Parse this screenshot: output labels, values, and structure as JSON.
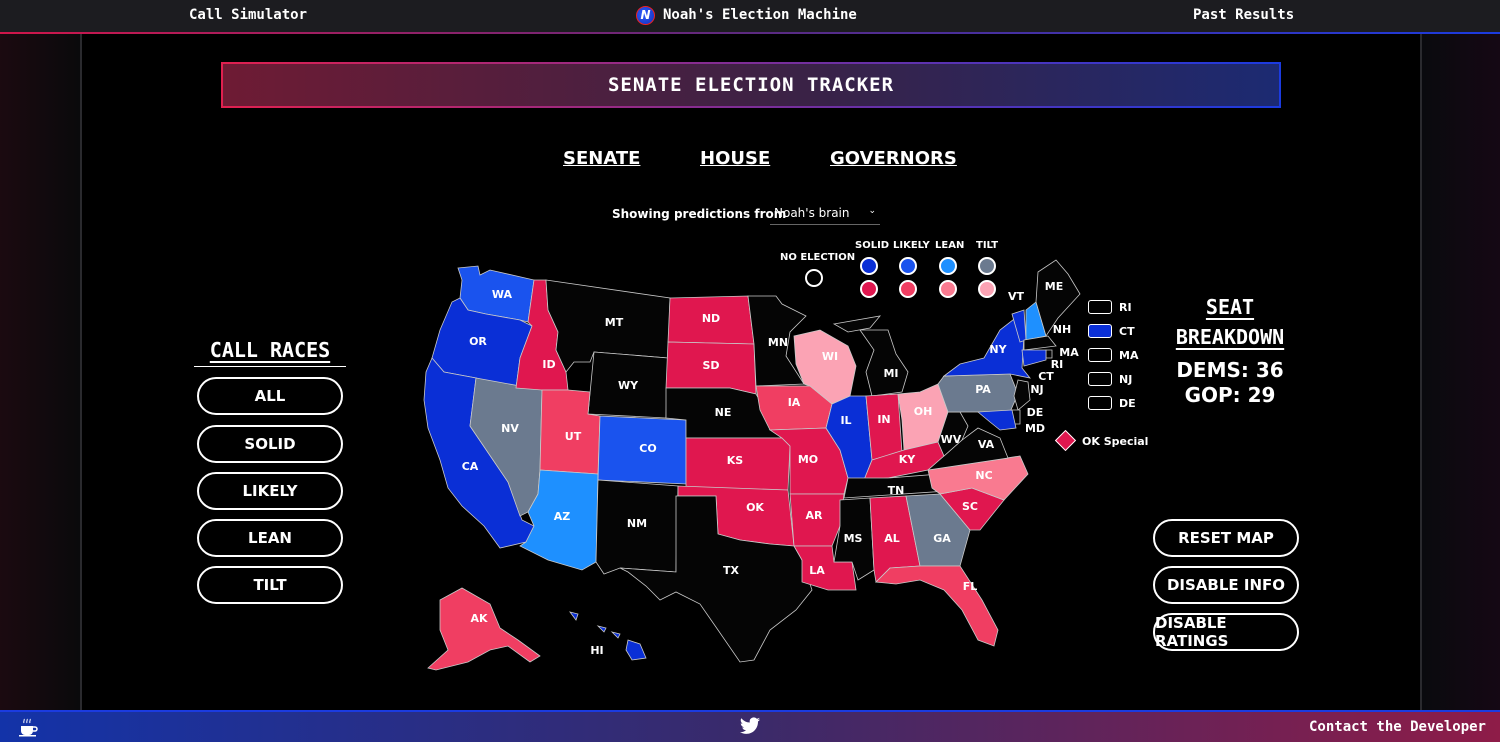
{
  "header": {
    "left_link": "Call Simulator",
    "brand": "Noah's Election Machine",
    "brand_logo_letter": "N",
    "right_link": "Past Results"
  },
  "banner": {
    "title": "SENATE ELECTION TRACKER"
  },
  "tabs": [
    "SENATE",
    "HOUSE",
    "GOVERNORS"
  ],
  "predictions": {
    "label": "Showing predictions from",
    "selected": "Noah's brain"
  },
  "legend": {
    "no_election": "NO ELECTION",
    "columns": [
      "SOLID",
      "LIKELY",
      "LEAN",
      "TILT"
    ],
    "dem_colors": [
      "#0a2fd6",
      "#1a53ee",
      "#1e90ff",
      "#6b7a8f"
    ],
    "gop_colors": [
      "#e0174f",
      "#f03e62",
      "#f97a90",
      "#fba3b4"
    ]
  },
  "small_states": [
    {
      "label": "RI",
      "color": "#000000"
    },
    {
      "label": "CT",
      "color": "#0a2fd6"
    },
    {
      "label": "MA",
      "color": "#000000"
    },
    {
      "label": "NJ",
      "color": "#000000"
    },
    {
      "label": "DE",
      "color": "#000000"
    }
  ],
  "special": {
    "label": "OK Special",
    "color": "#e0174f"
  },
  "call_races": {
    "title": "CALL RACES",
    "buttons": [
      "ALL",
      "SOLID",
      "LIKELY",
      "LEAN",
      "TILT"
    ]
  },
  "seat_breakdown": {
    "title_line1": "SEAT",
    "title_line2": "BREAKDOWN",
    "dems": "DEMS: 36",
    "gop": "GOP: 29"
  },
  "controls": [
    "RESET MAP",
    "DISABLE INFO",
    "DISABLE RATINGS"
  ],
  "map_states": [
    {
      "abbr": "WA",
      "rating": "likely-dem"
    },
    {
      "abbr": "OR",
      "rating": "solid-dem"
    },
    {
      "abbr": "CA",
      "rating": "solid-dem"
    },
    {
      "abbr": "NV",
      "rating": "tilt-dem"
    },
    {
      "abbr": "ID",
      "rating": "solid-gop"
    },
    {
      "abbr": "MT",
      "rating": "no-election"
    },
    {
      "abbr": "WY",
      "rating": "no-election"
    },
    {
      "abbr": "UT",
      "rating": "likely-gop"
    },
    {
      "abbr": "AZ",
      "rating": "lean-dem"
    },
    {
      "abbr": "CO",
      "rating": "likely-dem"
    },
    {
      "abbr": "NM",
      "rating": "no-election"
    },
    {
      "abbr": "ND",
      "rating": "solid-gop"
    },
    {
      "abbr": "SD",
      "rating": "solid-gop"
    },
    {
      "abbr": "NE",
      "rating": "no-election"
    },
    {
      "abbr": "KS",
      "rating": "solid-gop"
    },
    {
      "abbr": "OK",
      "rating": "solid-gop"
    },
    {
      "abbr": "TX",
      "rating": "no-election"
    },
    {
      "abbr": "MN",
      "rating": "no-election"
    },
    {
      "abbr": "IA",
      "rating": "likely-gop"
    },
    {
      "abbr": "MO",
      "rating": "solid-gop"
    },
    {
      "abbr": "AR",
      "rating": "solid-gop"
    },
    {
      "abbr": "LA",
      "rating": "solid-gop"
    },
    {
      "abbr": "WI",
      "rating": "tilt-gop"
    },
    {
      "abbr": "IL",
      "rating": "solid-dem"
    },
    {
      "abbr": "MI",
      "rating": "no-election"
    },
    {
      "abbr": "IN",
      "rating": "solid-gop"
    },
    {
      "abbr": "OH",
      "rating": "tilt-gop"
    },
    {
      "abbr": "KY",
      "rating": "solid-gop"
    },
    {
      "abbr": "TN",
      "rating": "no-election"
    },
    {
      "abbr": "MS",
      "rating": "no-election"
    },
    {
      "abbr": "AL",
      "rating": "solid-gop"
    },
    {
      "abbr": "GA",
      "rating": "tilt-dem"
    },
    {
      "abbr": "FL",
      "rating": "likely-gop"
    },
    {
      "abbr": "SC",
      "rating": "solid-gop"
    },
    {
      "abbr": "NC",
      "rating": "lean-gop"
    },
    {
      "abbr": "VA",
      "rating": "no-election"
    },
    {
      "abbr": "WV",
      "rating": "no-election"
    },
    {
      "abbr": "PA",
      "rating": "tilt-dem"
    },
    {
      "abbr": "NY",
      "rating": "solid-dem"
    },
    {
      "abbr": "VT",
      "rating": "solid-dem"
    },
    {
      "abbr": "NH",
      "rating": "lean-dem"
    },
    {
      "abbr": "ME",
      "rating": "no-election"
    },
    {
      "abbr": "MA",
      "rating": "no-election"
    },
    {
      "abbr": "RI",
      "rating": "no-election"
    },
    {
      "abbr": "CT",
      "rating": "solid-dem"
    },
    {
      "abbr": "NJ",
      "rating": "no-election"
    },
    {
      "abbr": "DE",
      "rating": "no-election"
    },
    {
      "abbr": "MD",
      "rating": "solid-dem"
    },
    {
      "abbr": "AK",
      "rating": "likely-gop"
    },
    {
      "abbr": "HI",
      "rating": "solid-dem"
    }
  ],
  "footer": {
    "coffee_icon": "coffee-icon",
    "twitter_icon": "twitter-icon",
    "contact": "Contact the Developer"
  }
}
